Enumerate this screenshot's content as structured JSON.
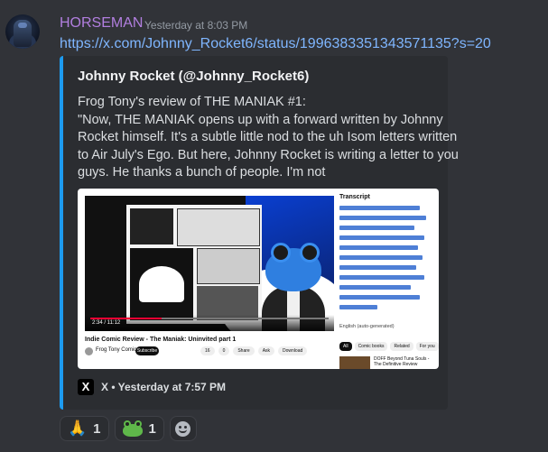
{
  "message": {
    "username": "HORSEMAN",
    "timestamp": "Yesterday at 8:03 PM",
    "link": "https://x.com/Johnny_Rocket6/status/1996383351343571135?s=20"
  },
  "embed": {
    "author": "Johnny Rocket (@Johnny_Rocket6)",
    "description_lines": [
      "Frog Tony's review of THE MANIAK #1:",
      "\"Now, THE MANIAK opens up with a forward written by Johnny",
      "Rocket himself. It's a subtle little nod to the uh Isom letters written",
      "to Air July's Ego. But here, Johnny Rocket is writing a letter to you",
      "guys. He thanks a bunch of people. I'm not"
    ],
    "footer": "X • Yesterday at 7:57 PM",
    "image": {
      "video_title": "Indie Comic Review - The Maniak: Uninvited part 1",
      "channel": "Frog Tony Comics",
      "subscribe": "Subscribe",
      "actions": [
        "16",
        "0",
        "Share",
        "Ask",
        "Download"
      ],
      "time": "2:34 / 11:12",
      "transcript_title": "Transcript",
      "transcript_foot": "English (auto-generated)",
      "chips": [
        "All",
        "Comic books",
        "Related",
        "For you"
      ],
      "thumb_text": "DOFF Beyond Tuna Souls - The Definitive Review"
    }
  },
  "reactions": [
    {
      "emoji": "🙏",
      "count": "1"
    },
    {
      "emoji": "frog",
      "count": "1"
    }
  ],
  "colors": {
    "background": "#313338",
    "embed_border": "#1d9bf0",
    "username": "#b27fe0",
    "link": "#7fb6ff"
  }
}
